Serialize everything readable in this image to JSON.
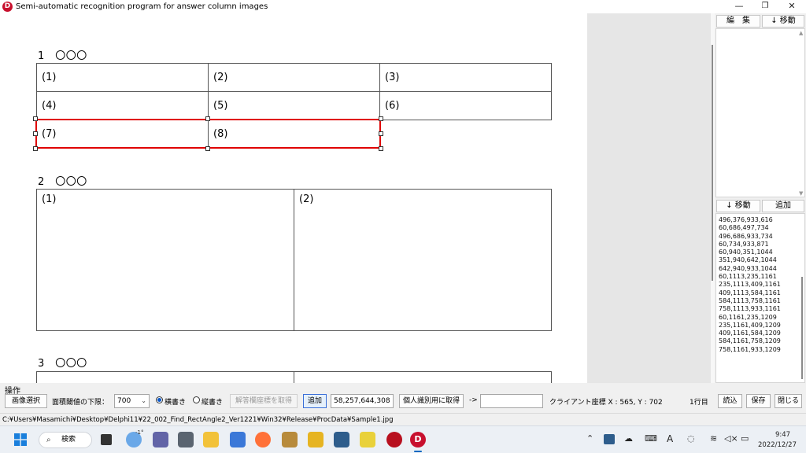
{
  "window": {
    "logo": "D",
    "title": "Semi-automatic recognition program for answer column images",
    "minimize": "—",
    "restore": "❐",
    "close": "✕"
  },
  "document": {
    "sections": [
      {
        "title": "1　〇〇〇",
        "cells": [
          "(1)",
          "(2)",
          "(3)",
          "(4)",
          "(5)",
          "(6)",
          "(7)",
          "(8)"
        ]
      },
      {
        "title": "2　〇〇〇",
        "cells": [
          "(1)",
          "(2)"
        ]
      },
      {
        "title": "3　〇〇〇",
        "cells": [
          "",
          ""
        ]
      }
    ]
  },
  "right_panel": {
    "edit_label": "編　集",
    "move_up_label": "↓ 移動",
    "move_down_label": "↓ 移動",
    "add_label": "追加",
    "coords": [
      "496,376,933,616",
      "60,686,497,734",
      "496,686,933,734",
      "60,734,933,871",
      "60,940,351,1044",
      "351,940,642,1044",
      "642,940,933,1044",
      "60,1113,235,1161",
      "235,1113,409,1161",
      "409,1113,584,1161",
      "584,1113,758,1161",
      "758,1113,933,1161",
      "60,1161,235,1209",
      "235,1161,409,1209",
      "409,1161,584,1209",
      "584,1161,758,1209",
      "758,1161,933,1209"
    ]
  },
  "operation": {
    "group_label": "操作",
    "select_image": "画像選択",
    "area_threshold_label": "面積閾値の下限：",
    "area_threshold_value": "700",
    "horizontal_label": "横書き",
    "vertical_label": "縦書き",
    "writing_mode_selected": "横書き",
    "get_answer_coords": "解答欄座標を取得",
    "add": "追加",
    "coords_value": "58,257,644,308",
    "get_personal_id": "個人識別用に取得",
    "arrow": "->",
    "target_value": "",
    "client_coords": "クライアント座標  X : 565, Y : 702",
    "line_no": "1行目",
    "load": "読込",
    "save": "保存",
    "close": "閉じる"
  },
  "status": {
    "path": "C:¥Users¥Masamichi¥Desktop¥Delphi11¥22_002_Find_RectAngle2_Ver1221¥Win32¥Release¥ProcData¥Sample1.jpg"
  },
  "taskbar": {
    "search_label": "検索",
    "weather_temp": "-1°",
    "ime_label": "A",
    "time": "9:47",
    "date": "2022/12/27"
  }
}
